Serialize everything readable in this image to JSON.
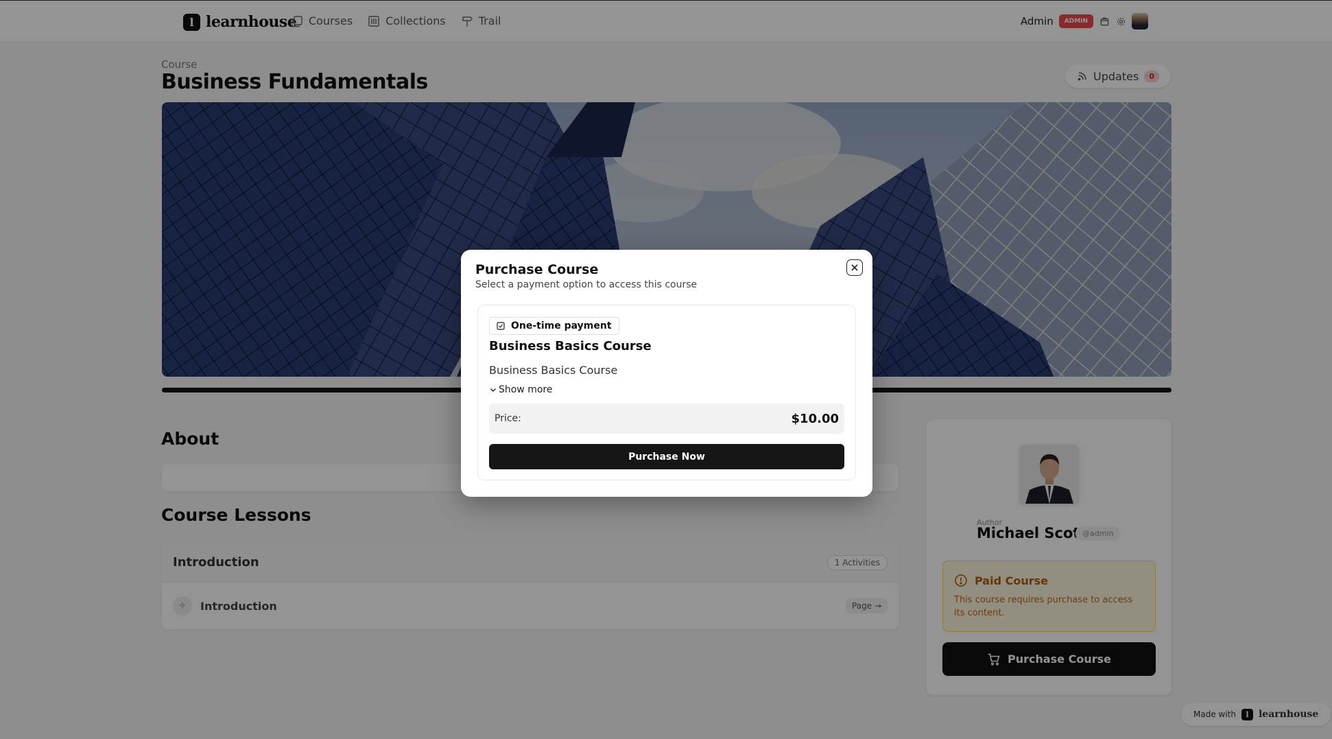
{
  "nav": {
    "brand": "learnhouse",
    "links": [
      {
        "label": "Courses",
        "icon": "courses-icon"
      },
      {
        "label": "Collections",
        "icon": "collections-icon"
      },
      {
        "label": "Trail",
        "icon": "signpost-icon"
      }
    ],
    "user_name": "Admin",
    "role_badge": "ADMIN"
  },
  "course": {
    "breadcrumb": "Course",
    "title": "Business Fundamentals",
    "updates_label": "Updates",
    "updates_count": "0"
  },
  "about": {
    "heading": "About"
  },
  "lessons": {
    "heading": "Course Lessons",
    "chapter_title": "Introduction",
    "activities_count": "1 Activities",
    "activity_title": "Introduction",
    "activity_type": "Page"
  },
  "author": {
    "label": "Author",
    "name": "Michael Scott",
    "handle": "@admin"
  },
  "paid_notice": {
    "title": "Paid Course",
    "description": "This course requires purchase to access its content."
  },
  "sidebar_purchase_label": "Purchase Course",
  "footer": {
    "made_with": "Made with",
    "brand": "learnhouse"
  },
  "modal": {
    "title": "Purchase Course",
    "subtitle": "Select a payment option to access this course",
    "offer": {
      "payment_type": "One-time payment",
      "name": "Business Basics Course",
      "description": "Business Basics Course",
      "show_more": "Show more",
      "price_label": "Price:",
      "price_value": "$10.00",
      "cta": "Purchase Now"
    }
  },
  "colors": {
    "admin_badge": "#e8484f",
    "paid_notice_bg": "#fdf7dc",
    "paid_notice_text": "#b25a10",
    "primary_button": "#161616"
  }
}
